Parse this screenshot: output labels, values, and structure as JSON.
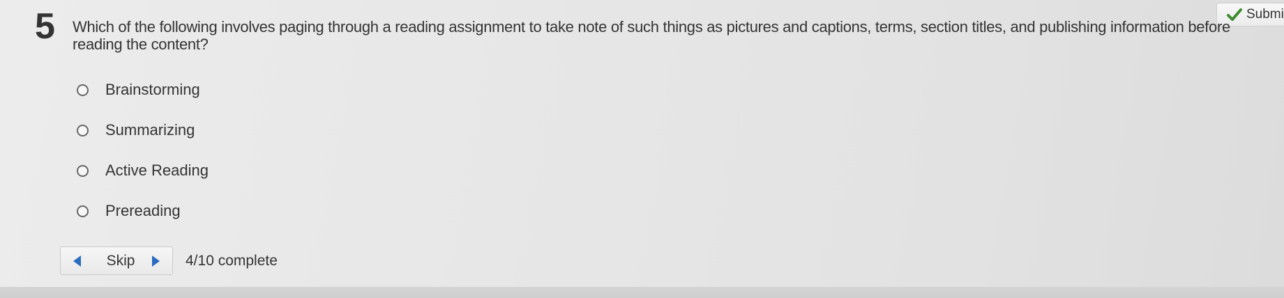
{
  "header": {
    "submit_label": "Submit",
    "submit_icon": "check-icon"
  },
  "question": {
    "number": "5",
    "text": "Which of the following involves paging through a reading assignment to take note of such things as pictures and captions, terms, section titles, and publishing information before reading the content?"
  },
  "options": [
    {
      "label": "Brainstorming",
      "selected": false
    },
    {
      "label": "Summarizing",
      "selected": false
    },
    {
      "label": "Active Reading",
      "selected": false
    },
    {
      "label": "Prereading",
      "selected": false
    }
  ],
  "navigation": {
    "skip_label": "Skip",
    "progress_text": "4/10 complete"
  },
  "colors": {
    "accent_blue": "#2a6cc0",
    "check_green": "#3c8a2e",
    "text": "#333333"
  }
}
